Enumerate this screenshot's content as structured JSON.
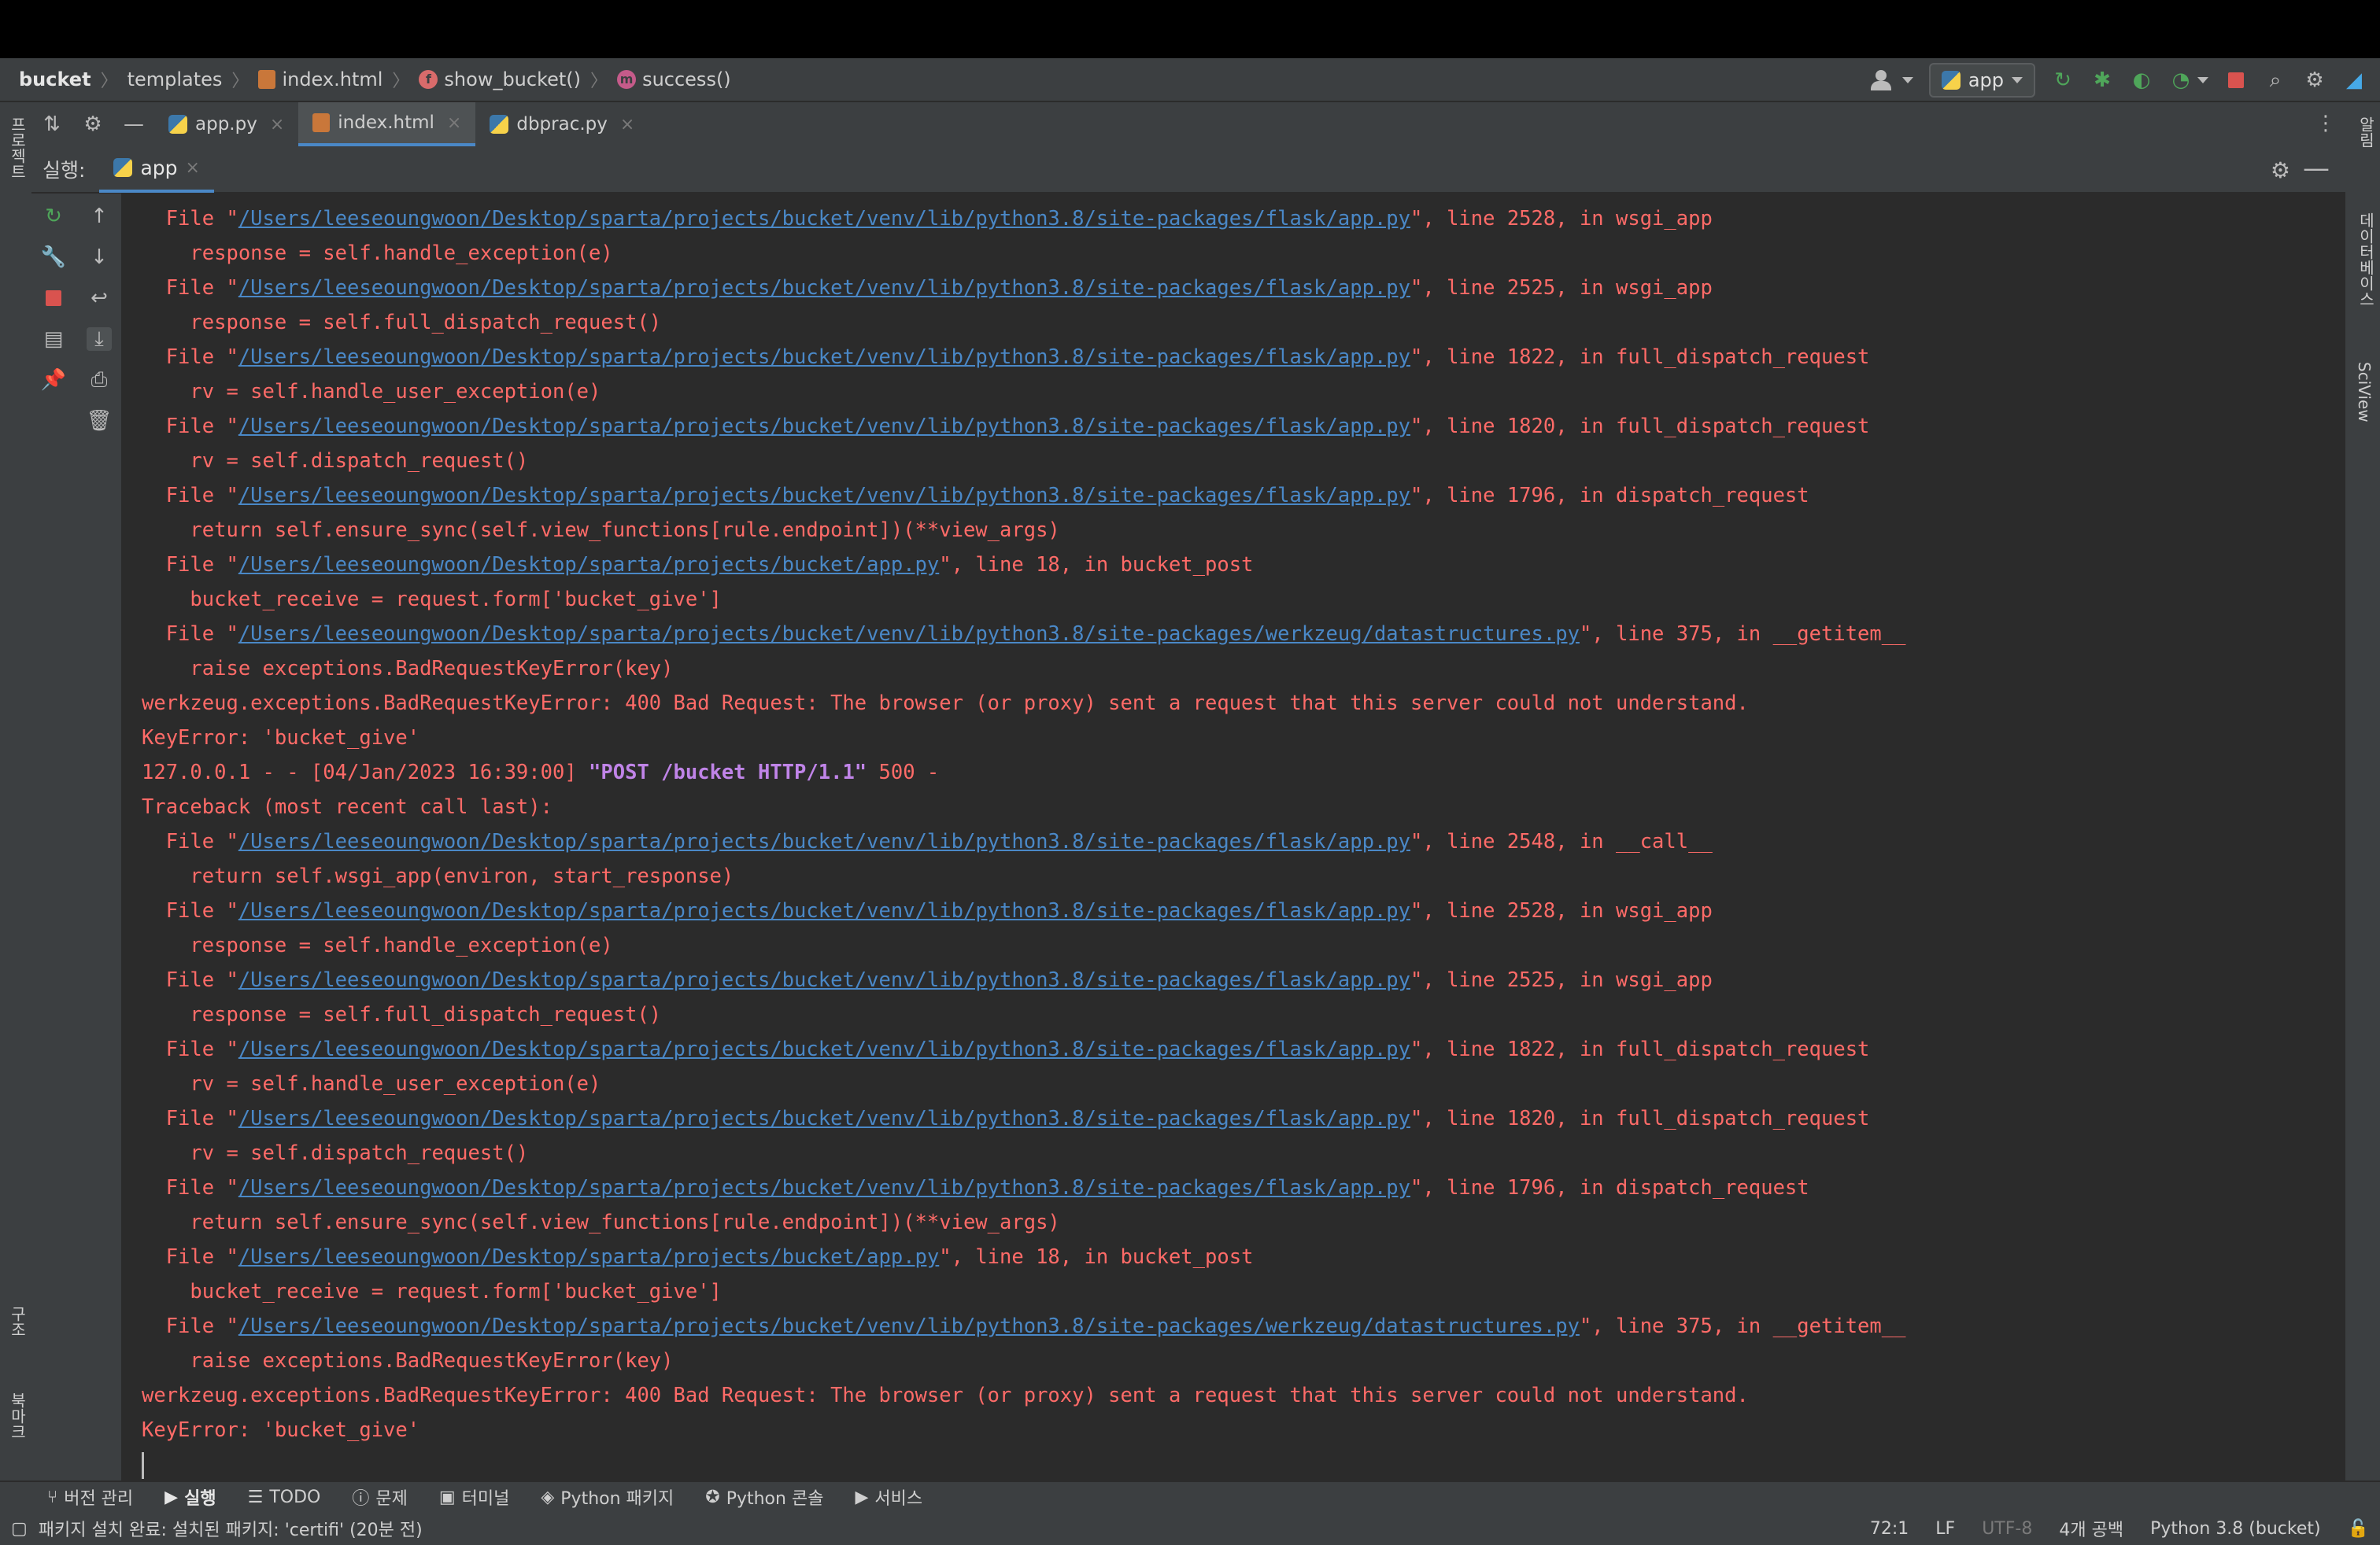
{
  "breadcrumb": {
    "project": "bucket",
    "folder": "templates",
    "file": "index.html",
    "function_badge": "f",
    "function": "show_bucket()",
    "method_badge": "m",
    "method": "success()"
  },
  "toolbar": {
    "run_config": "app",
    "icons": [
      "user-icon",
      "rerun-icon",
      "debug-icon",
      "coverage-icon",
      "profile-icon",
      "stop-icon",
      "search-icon",
      "gear-icon",
      "logo-icon"
    ]
  },
  "left_strip": {
    "top_label": "프로젝트",
    "mid_label": "구조",
    "bottom_label": "북마크"
  },
  "right_strip": {
    "label1": "알림",
    "label2": "데이터베이스",
    "label3": "SciView"
  },
  "editor_tabs": [
    {
      "label": "app.py",
      "active": false
    },
    {
      "label": "index.html",
      "active": true
    },
    {
      "label": "dbprac.py",
      "active": false
    }
  ],
  "run_panel": {
    "label": "실행:",
    "tab": "app"
  },
  "console": {
    "lines": [
      {
        "pre": "  File \"",
        "link": "/Users/leeseoungwoon/Desktop/sparta/projects/bucket/venv/lib/python3.8/site-packages/flask/app.py",
        "post": "\", line 2528, in wsgi_app"
      },
      {
        "pre": "    response = self.handle_exception(e)",
        "link": "",
        "post": ""
      },
      {
        "pre": "  File \"",
        "link": "/Users/leeseoungwoon/Desktop/sparta/projects/bucket/venv/lib/python3.8/site-packages/flask/app.py",
        "post": "\", line 2525, in wsgi_app"
      },
      {
        "pre": "    response = self.full_dispatch_request()",
        "link": "",
        "post": ""
      },
      {
        "pre": "  File \"",
        "link": "/Users/leeseoungwoon/Desktop/sparta/projects/bucket/venv/lib/python3.8/site-packages/flask/app.py",
        "post": "\", line 1822, in full_dispatch_request"
      },
      {
        "pre": "    rv = self.handle_user_exception(e)",
        "link": "",
        "post": ""
      },
      {
        "pre": "  File \"",
        "link": "/Users/leeseoungwoon/Desktop/sparta/projects/bucket/venv/lib/python3.8/site-packages/flask/app.py",
        "post": "\", line 1820, in full_dispatch_request"
      },
      {
        "pre": "    rv = self.dispatch_request()",
        "link": "",
        "post": ""
      },
      {
        "pre": "  File \"",
        "link": "/Users/leeseoungwoon/Desktop/sparta/projects/bucket/venv/lib/python3.8/site-packages/flask/app.py",
        "post": "\", line 1796, in dispatch_request"
      },
      {
        "pre": "    return self.ensure_sync(self.view_functions[rule.endpoint])(**view_args)",
        "link": "",
        "post": ""
      },
      {
        "pre": "  File \"",
        "link": "/Users/leeseoungwoon/Desktop/sparta/projects/bucket/app.py",
        "post": "\", line 18, in bucket_post"
      },
      {
        "pre": "    bucket_receive = request.form['bucket_give']",
        "link": "",
        "post": ""
      },
      {
        "pre": "  File \"",
        "link": "/Users/leeseoungwoon/Desktop/sparta/projects/bucket/venv/lib/python3.8/site-packages/werkzeug/datastructures.py",
        "post": "\", line 375, in __getitem__"
      },
      {
        "pre": "    raise exceptions.BadRequestKeyError(key)",
        "link": "",
        "post": ""
      },
      {
        "pre": "werkzeug.exceptions.BadRequestKeyError: 400 Bad Request: The browser (or proxy) sent a request that this server could not understand.",
        "link": "",
        "post": ""
      },
      {
        "pre": "KeyError: 'bucket_give'",
        "link": "",
        "post": ""
      },
      {
        "pre": "127.0.0.1 - - [04/Jan/2023 16:39:00] ",
        "req": "\"POST /bucket HTTP/1.1\"",
        "link": "",
        "post": " 500 -",
        "plain": true
      },
      {
        "pre": "Traceback (most recent call last):",
        "link": "",
        "post": ""
      },
      {
        "pre": "  File \"",
        "link": "/Users/leeseoungwoon/Desktop/sparta/projects/bucket/venv/lib/python3.8/site-packages/flask/app.py",
        "post": "\", line 2548, in __call__"
      },
      {
        "pre": "    return self.wsgi_app(environ, start_response)",
        "link": "",
        "post": ""
      },
      {
        "pre": "  File \"",
        "link": "/Users/leeseoungwoon/Desktop/sparta/projects/bucket/venv/lib/python3.8/site-packages/flask/app.py",
        "post": "\", line 2528, in wsgi_app"
      },
      {
        "pre": "    response = self.handle_exception(e)",
        "link": "",
        "post": ""
      },
      {
        "pre": "  File \"",
        "link": "/Users/leeseoungwoon/Desktop/sparta/projects/bucket/venv/lib/python3.8/site-packages/flask/app.py",
        "post": "\", line 2525, in wsgi_app"
      },
      {
        "pre": "    response = self.full_dispatch_request()",
        "link": "",
        "post": ""
      },
      {
        "pre": "  File \"",
        "link": "/Users/leeseoungwoon/Desktop/sparta/projects/bucket/venv/lib/python3.8/site-packages/flask/app.py",
        "post": "\", line 1822, in full_dispatch_request"
      },
      {
        "pre": "    rv = self.handle_user_exception(e)",
        "link": "",
        "post": ""
      },
      {
        "pre": "  File \"",
        "link": "/Users/leeseoungwoon/Desktop/sparta/projects/bucket/venv/lib/python3.8/site-packages/flask/app.py",
        "post": "\", line 1820, in full_dispatch_request"
      },
      {
        "pre": "    rv = self.dispatch_request()",
        "link": "",
        "post": ""
      },
      {
        "pre": "  File \"",
        "link": "/Users/leeseoungwoon/Desktop/sparta/projects/bucket/venv/lib/python3.8/site-packages/flask/app.py",
        "post": "\", line 1796, in dispatch_request"
      },
      {
        "pre": "    return self.ensure_sync(self.view_functions[rule.endpoint])(**view_args)",
        "link": "",
        "post": ""
      },
      {
        "pre": "  File \"",
        "link": "/Users/leeseoungwoon/Desktop/sparta/projects/bucket/app.py",
        "post": "\", line 18, in bucket_post"
      },
      {
        "pre": "    bucket_receive = request.form['bucket_give']",
        "link": "",
        "post": ""
      },
      {
        "pre": "  File \"",
        "link": "/Users/leeseoungwoon/Desktop/sparta/projects/bucket/venv/lib/python3.8/site-packages/werkzeug/datastructures.py",
        "post": "\", line 375, in __getitem__"
      },
      {
        "pre": "    raise exceptions.BadRequestKeyError(key)",
        "link": "",
        "post": ""
      },
      {
        "pre": "werkzeug.exceptions.BadRequestKeyError: 400 Bad Request: The browser (or proxy) sent a request that this server could not understand.",
        "link": "",
        "post": ""
      },
      {
        "pre": "KeyError: 'bucket_give'",
        "link": "",
        "post": ""
      }
    ]
  },
  "bottom_tabs": [
    {
      "icon": "vcs-icon",
      "label": "버전 관리",
      "active": false
    },
    {
      "icon": "run-icon",
      "label": "실행",
      "active": true
    },
    {
      "icon": "todo-icon",
      "label": "TODO",
      "active": false
    },
    {
      "icon": "problems-icon",
      "label": "문제",
      "active": false
    },
    {
      "icon": "terminal-icon",
      "label": "터미널",
      "active": false
    },
    {
      "icon": "python-packages-icon",
      "label": "Python 패키지",
      "active": false
    },
    {
      "icon": "python-console-icon",
      "label": "Python 콘솔",
      "active": false
    },
    {
      "icon": "services-icon",
      "label": "서비스",
      "active": false
    }
  ],
  "status": {
    "message": "패키지 설치 완료: 설치된 패키지: 'certifi' (20분 전)",
    "position": "72:1",
    "line_sep": "LF",
    "encoding": "UTF-8",
    "indent": "4개 공백",
    "interpreter": "Python 3.8 (bucket)"
  },
  "colors": {
    "error_text": "#ff6b68",
    "link": "#4a88c7",
    "request": "#c084e8",
    "panel_bg": "#3c3f41",
    "console_bg": "#2b2b2b"
  }
}
